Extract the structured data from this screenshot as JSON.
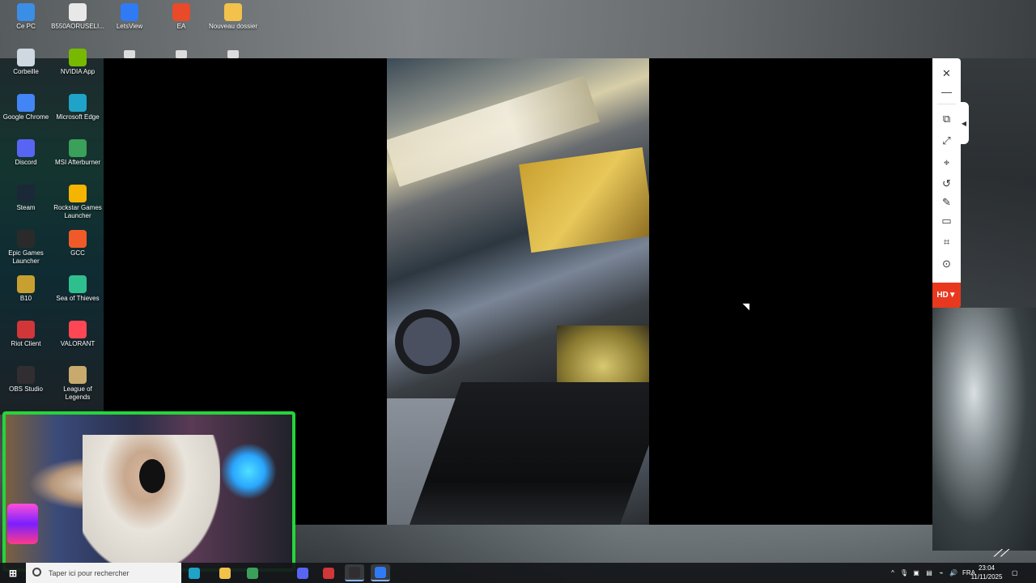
{
  "desktop": {
    "icons": [
      {
        "label": "Ce PC",
        "icon": "computer-icon",
        "color": "#3a8ee6"
      },
      {
        "label": "B550AORUSELI...",
        "icon": "file-icon",
        "color": "#e8e8e8"
      },
      {
        "label": "LetsView",
        "icon": "letsview-icon",
        "color": "#2f7bf5"
      },
      {
        "label": "EA",
        "icon": "ea-icon",
        "color": "#e84a2a"
      },
      {
        "label": "Nouveau dossier",
        "icon": "folder-icon",
        "color": "#f2c24a"
      },
      {
        "label": "Corbeille",
        "icon": "recycle-bin-icon",
        "color": "#cfd8e0"
      },
      {
        "label": "NVIDIA App",
        "icon": "nvidia-icon",
        "color": "#76b900"
      },
      {
        "label": "Google Chrome",
        "icon": "chrome-icon",
        "color": "#4285f4"
      },
      {
        "label": "Microsoft Edge",
        "icon": "edge-icon",
        "color": "#1fa3c8"
      },
      {
        "label": "Discord",
        "icon": "discord-icon",
        "color": "#5865f2"
      },
      {
        "label": "MSI Afterburner",
        "icon": "afterburner-icon",
        "color": "#3aa05a"
      },
      {
        "label": "Steam",
        "icon": "steam-icon",
        "color": "#1b2838"
      },
      {
        "label": "Rockstar Games Launcher",
        "icon": "rockstar-icon",
        "color": "#f5b400"
      },
      {
        "label": "Epic Games Launcher",
        "icon": "epic-icon",
        "color": "#2a2a2a"
      },
      {
        "label": "GCC",
        "icon": "gcc-icon",
        "color": "#f05a28"
      },
      {
        "label": "B10",
        "icon": "b10-icon",
        "color": "#c8a030"
      },
      {
        "label": "Sea of Thieves",
        "icon": "sea-of-thieves-icon",
        "color": "#2fbf8f"
      },
      {
        "label": "Riot Client",
        "icon": "riot-icon",
        "color": "#d13639"
      },
      {
        "label": "VALORANT",
        "icon": "valorant-icon",
        "color": "#ff4655"
      },
      {
        "label": "OBS Studio",
        "icon": "obs-icon",
        "color": "#302e31"
      },
      {
        "label": "League of Legends",
        "icon": "league-icon",
        "color": "#c8aa6e"
      }
    ],
    "partial_row": [
      "file-icon",
      "game-icon",
      "folder-icon"
    ]
  },
  "viewer": {
    "tools": [
      {
        "name": "close-button",
        "glyph": "✕"
      },
      {
        "name": "minimize-button",
        "glyph": "—"
      },
      {
        "name": "screen-mirror-button",
        "glyph": "⧉"
      },
      {
        "name": "fullscreen-button",
        "glyph": "⤢"
      },
      {
        "name": "pin-button",
        "glyph": "⌖"
      },
      {
        "name": "rotate-button",
        "glyph": "↺"
      },
      {
        "name": "draw-button",
        "glyph": "✎"
      },
      {
        "name": "whiteboard-button",
        "glyph": "▭"
      },
      {
        "name": "crop-button",
        "glyph": "⌗"
      },
      {
        "name": "record-button",
        "glyph": "⊙"
      }
    ],
    "side_tab_glyph": "◀",
    "quality_label": "HD▼",
    "quality_color": "#e8391f"
  },
  "taskbar": {
    "search_placeholder": "Taper ici pour rechercher",
    "apps": [
      {
        "name": "edge-taskbar",
        "label": "",
        "color": "#1fa3c8",
        "active": false
      },
      {
        "name": "explorer-taskbar",
        "label": "",
        "color": "#f2c24a",
        "active": false
      },
      {
        "name": "app-taskbar",
        "label": "",
        "color": "#3aa05a",
        "active": false
      },
      {
        "name": "discord-taskbar",
        "label": "",
        "color": "#5865f2",
        "active": false
      },
      {
        "name": "rockstar-taskbar",
        "label": "",
        "color": "#d13639",
        "active": false
      },
      {
        "name": "obs-taskbar",
        "label": "",
        "color": "#302e31",
        "active": true
      },
      {
        "name": "letsview-taskbar",
        "label": "",
        "color": "#2f7bf5",
        "active": true
      }
    ],
    "language": "FRA",
    "time": "23:04",
    "date": "11/11/2025"
  }
}
